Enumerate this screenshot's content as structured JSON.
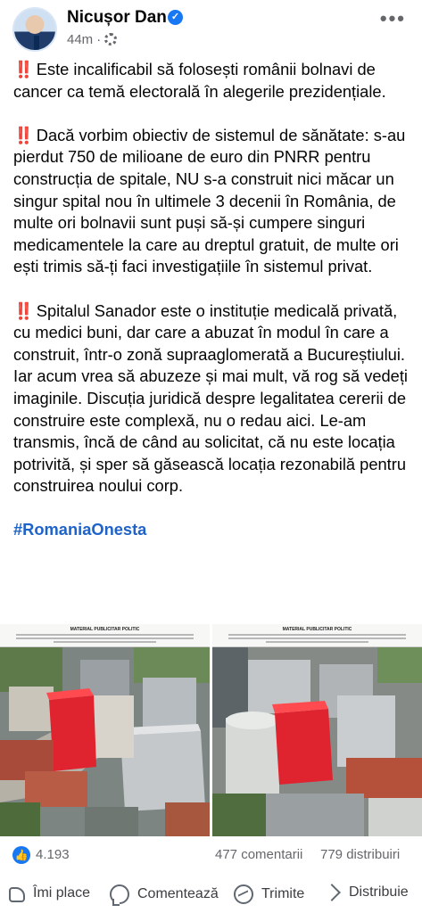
{
  "post": {
    "author": "Nicușor Dan",
    "time": "44m",
    "separator": "·",
    "more": "•••",
    "emoji": "‼️",
    "paragraphs": [
      "Este incalificabil să folosești românii bolnavi de cancer ca temă electorală în alegerile prezidențiale.",
      "Dacă vorbim obiectiv de sistemul de sănătate: s-au pierdut 750 de milioane de euro din PNRR pentru construcția de spitale, NU s-a construit nici măcar un singur spital nou în ultimele 3 decenii în România, de multe ori bolnavii sunt puși să-și cumpere singuri medicamentele la care au dreptul gratuit, de multe ori ești trimis să-ți faci investigațiile în sistemul privat.",
      "Spitalul Sanador este o instituție medicală privată, cu medici buni, dar care a abuzat în modul în care a construit, într-o zonă supraaglomerată a Bucureștiului. Iar acum vrea să abuzeze și mai mult, vă rog să vedeți imaginile. Discuția juridică despre legalitatea cererii de construire este complexă, nu o redau aici. Le-am transmis, încă de când au solicitat, că nu este locația potrivită, și sper să găsească locația rezonabilă pentru construirea noului corp."
    ],
    "hashtag": "#RomaniaOnesta",
    "photo_disclaimer": "MATERIAL PUBLICITAR POLITIC",
    "reactions_count": "4.193",
    "comments_count": "477 comentarii",
    "shares_count": "779 distribuiri"
  },
  "actions": {
    "like": "Îmi place",
    "comment": "Comentează",
    "send": "Trimite",
    "share": "Distribuie"
  },
  "icons": {
    "verified": "verified-badge-icon",
    "audience": "gear-icon",
    "like_badge": "thumbs-up-icon"
  },
  "colors": {
    "accent": "#1877f2",
    "hashtag": "#1d63c9",
    "highlight_building": "#e0242f",
    "secondary_text": "#65676b"
  }
}
